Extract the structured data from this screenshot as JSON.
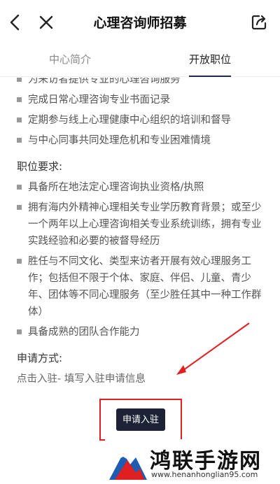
{
  "header": {
    "title": "心理咨询师招募"
  },
  "tabs": [
    {
      "label": "中心简介",
      "active": false
    },
    {
      "label": "开放职位",
      "active": true
    }
  ],
  "duties": [
    "为来访者提供专业的心理咨询服务",
    "完成日常心理咨询专业书面记录",
    "定期参与线上心理健康中心组织的培训和督导",
    "与中心同事共同处理危机和专业困难情境"
  ],
  "requirements": {
    "title": "职位要求:",
    "items": [
      "具备所在地法定心理咨询执业资格/执照",
      "拥有海内外精神心理相关专业学历教育背景；或至少一个两年以上心理咨询相关专业系统训练，拥有专业实践经验和必要的被督导经历",
      "胜任与不同文化、类型来访者开展有效心理服务工作；包括但不限于个体、家庭、伴侣、儿童、青少年、团体等不同心理服务（至少胜任其中一种工作群体）",
      "具备成熟的团队合作能力"
    ]
  },
  "apply": {
    "title": "申请方式:",
    "method": "点击入驻- 填写入驻申请信息",
    "button_label": "申请入驻"
  },
  "watermark": {
    "title": "鸿联手游网",
    "url": "www.henanhonglian95.com"
  },
  "colors": {
    "accent": "#1a2a48",
    "highlight": "#e02020"
  },
  "icons": {
    "back": "chevron-left-icon",
    "close": "close-icon",
    "share": "share-icon"
  }
}
